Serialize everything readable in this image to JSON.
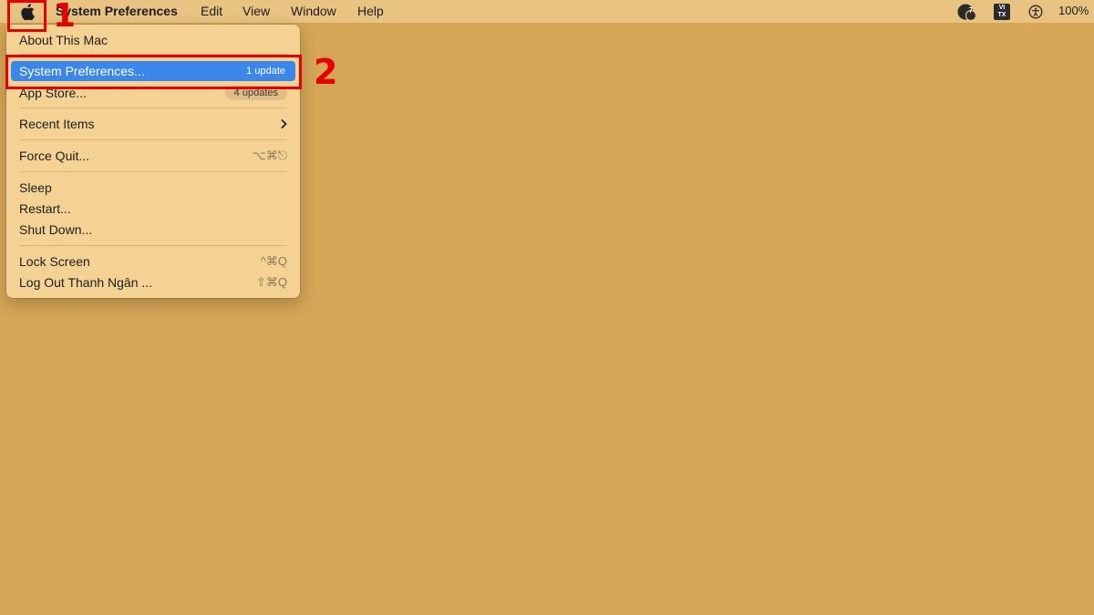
{
  "menubar": {
    "app_name": "System Preferences",
    "items": [
      "Edit",
      "View",
      "Window",
      "Help"
    ],
    "notification_count": "7",
    "input_source": "VI TX",
    "battery": "100%"
  },
  "apple_menu": {
    "about": "About This Mac",
    "system_preferences": {
      "label": "System Preferences...",
      "badge": "1 update"
    },
    "app_store": {
      "label": "App Store...",
      "badge": "4 updates"
    },
    "recent_items": "Recent Items",
    "force_quit": {
      "label": "Force Quit...",
      "shortcut": "⌥⌘⎋"
    },
    "sleep": "Sleep",
    "restart": "Restart...",
    "shut_down": "Shut Down...",
    "lock_screen": {
      "label": "Lock Screen",
      "shortcut": "^⌘Q"
    },
    "log_out": {
      "label": "Log Out Thanh Ngân ...",
      "shortcut": "⇧⌘Q"
    }
  },
  "annotations": {
    "step1": "1",
    "step2": "2"
  },
  "colors": {
    "accent": "#3b86ea",
    "annotation": "#e60000",
    "desktop": "#d4a656"
  }
}
